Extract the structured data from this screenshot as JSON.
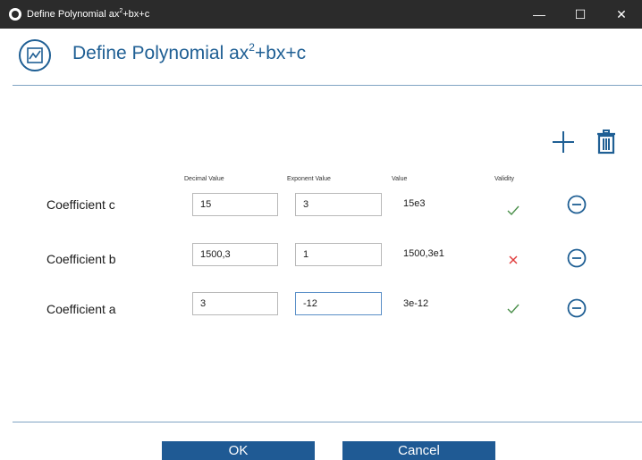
{
  "window": {
    "title_base": "Define Polynomial ax",
    "title_exp": "2",
    "title_rest": "+bx+c",
    "minimize_glyph": "—",
    "maximize_glyph": "☐",
    "close_glyph": "✕"
  },
  "header": {
    "title_base": "Define Polynomial ax",
    "title_exp": "2",
    "title_rest": "+bx+c",
    "icon": "chart-icon",
    "accent_color": "#1f5f94"
  },
  "toolbar": {
    "add_icon": "plus-icon",
    "delete_icon": "trash-icon"
  },
  "columns": {
    "decimal": "Decimal Value",
    "exponent": "Exponent Value",
    "value": "Value",
    "validity": "Validity"
  },
  "rows": [
    {
      "label": "Coefficient c",
      "decimal": "15",
      "exponent": "3",
      "value": "15e3",
      "valid": true
    },
    {
      "label": "Coefficient b",
      "decimal": "1500,3",
      "exponent": "1",
      "value": "1500,3e1",
      "valid": false
    },
    {
      "label": "Coefficient a",
      "decimal": "3",
      "exponent": "-12",
      "value": "3e-12",
      "valid": true
    }
  ],
  "colors": {
    "valid": "#4a8f4a",
    "invalid": "#e03b3b",
    "primary_button": "#1f5a94"
  },
  "footer": {
    "ok_label": "OK",
    "cancel_label": "Cancel"
  }
}
